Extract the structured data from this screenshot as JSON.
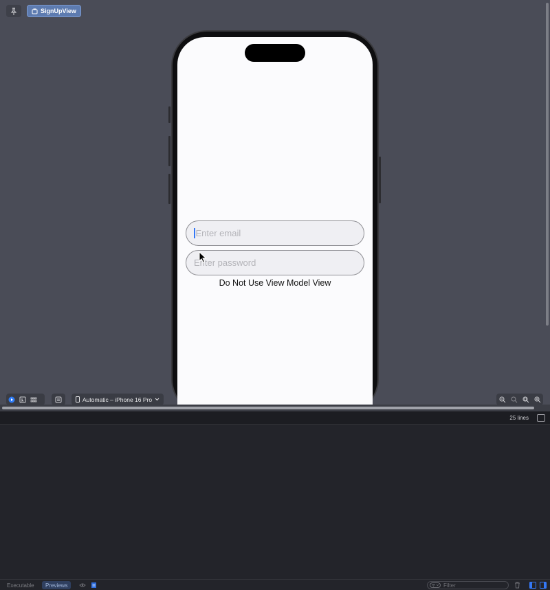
{
  "canvas": {
    "preview_chip_label": "SignUpView"
  },
  "app_preview": {
    "email_placeholder": "Enter email",
    "password_placeholder": "Enter password",
    "label_text": "Do Not Use View Model View"
  },
  "preview_toolbar": {
    "device_label": "Automatic – iPhone 16 Pro"
  },
  "console": {
    "lines_count": "25 lines"
  },
  "statusbar": {
    "tabs": [
      {
        "label": "Executable",
        "active": false
      },
      {
        "label": "Previews",
        "active": true
      }
    ],
    "filter_placeholder": "Filter"
  },
  "colors": {
    "accent": "#3478f6",
    "canvas_bg": "#4a4c57",
    "chip_bg": "#5d7bb0"
  }
}
